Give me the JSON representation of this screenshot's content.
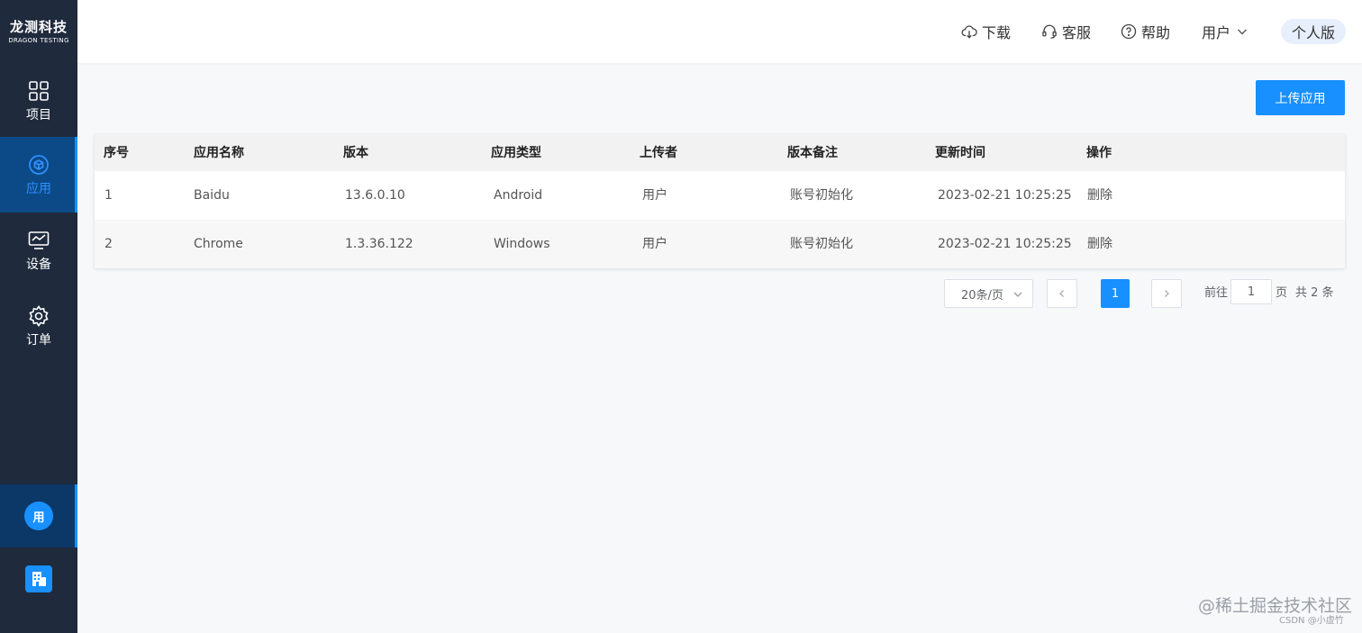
{
  "logo": {
    "main": "龙测科技",
    "sub": "DRAGON TESTING"
  },
  "sidebar": {
    "items": [
      {
        "label": "项目",
        "icon": "grid-icon"
      },
      {
        "label": "应用",
        "icon": "cube-icon",
        "active": true
      },
      {
        "label": "设备",
        "icon": "monitor-icon"
      },
      {
        "label": "订单",
        "icon": "gear-icon"
      }
    ],
    "user_avatar": "用",
    "accent": "#1890ff",
    "bg": "#1f2a3d"
  },
  "header": {
    "download": "下载",
    "service": "客服",
    "help": "帮助",
    "user": "用户",
    "edition": "个人版"
  },
  "toolbar": {
    "upload_label": "上传应用"
  },
  "table": {
    "columns": [
      "序号",
      "应用名称",
      "版本",
      "应用类型",
      "上传者",
      "版本备注",
      "更新时间",
      "操作"
    ],
    "rows": [
      {
        "index": "1",
        "name": "Baidu",
        "version": "13.6.0.10",
        "type": "Android",
        "uploader": "用户",
        "note": "账号初始化",
        "updated": "2023-02-21 10:25:25",
        "action": "删除"
      },
      {
        "index": "2",
        "name": "Chrome",
        "version": "1.3.36.122",
        "type": "Windows",
        "uploader": "用户",
        "note": "账号初始化",
        "updated": "2023-02-21 10:25:25",
        "action": "删除"
      }
    ]
  },
  "pagination": {
    "page_size": "20条/页",
    "current_page": "1",
    "goto_prefix": "前往",
    "goto_value": "1",
    "goto_suffix": "页",
    "total": "共 2 条"
  },
  "watermark": {
    "main": "@稀土掘金技术社区",
    "sub": "CSDN @小虚竹"
  }
}
